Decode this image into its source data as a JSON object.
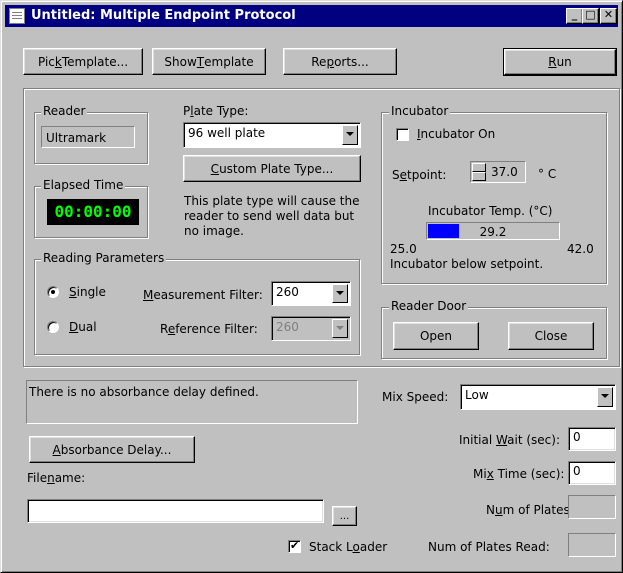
{
  "window": {
    "title": "Untitled: Multiple Endpoint Protocol",
    "minimize": "_",
    "maximize": "□",
    "close": "✕"
  },
  "toolbar": {
    "pick_template_pre": "Pic",
    "pick_template_u": "k",
    "pick_template_post": " Template...",
    "show_template_pre": "Show ",
    "show_template_u": "T",
    "show_template_post": "emplate",
    "reports_pre": "Re",
    "reports_u": "p",
    "reports_post": "orts...",
    "run_u": "R",
    "run_post": "un"
  },
  "reader": {
    "group_label": "Reader",
    "value": "Ultramark"
  },
  "elapsed": {
    "group_label": "Elapsed Time",
    "value": "00:00:00"
  },
  "plate": {
    "label_pre": "P",
    "label_u": "l",
    "label_post": "ate Type:",
    "selected": "96 well plate",
    "custom_u": "C",
    "custom_post": "ustom Plate Type...",
    "note": "This plate type will cause the reader to send well data but no image."
  },
  "reading_params": {
    "group_label": "Reading Parameters",
    "single_u": "S",
    "single_post": "ingle",
    "dual_u": "D",
    "dual_post": "ual",
    "meas_u": "M",
    "meas_post": "easurement Filter:",
    "meas_value": "260",
    "ref_pre": "R",
    "ref_u": "e",
    "ref_post": "ference Filter:",
    "ref_value": "260"
  },
  "incubator": {
    "group_label": "Incubator",
    "on_u": "I",
    "on_post": "ncubator On",
    "on_checked": false,
    "setpoint_pre": "S",
    "setpoint_u": "e",
    "setpoint_post": "tpoint:",
    "setpoint_value": "37.0",
    "unit": "° C",
    "temp_label": "Incubator Temp. (°C)",
    "temp_value": "29.2",
    "temp_fraction": 0.24,
    "min": "25.0",
    "max": "42.0",
    "status": "Incubator below setpoint."
  },
  "door": {
    "group_label": "Reader Door",
    "open": "Open",
    "close": "Close"
  },
  "delay": {
    "message": "There is no absorbance delay defined.",
    "button_u": "A",
    "button_post": "bsorbance Delay..."
  },
  "filename": {
    "label_pre": "File",
    "label_u": "n",
    "label_post": "ame:",
    "value": "",
    "browse": "..."
  },
  "stack_loader": {
    "label_pre": "Stack L",
    "label_u": "o",
    "label_post": "ader",
    "checked": true
  },
  "mix": {
    "label": "Mix Speed:",
    "value": "Low"
  },
  "initial_wait": {
    "pre": "Initial ",
    "u": "W",
    "post": "ait (sec):",
    "value": "0"
  },
  "mix_time": {
    "pre": "Mi",
    "u": "x",
    "post": " Time (sec):",
    "value": "0"
  },
  "num_plates": {
    "pre": "N",
    "u": "u",
    "post": "m of Plates:",
    "value": ""
  },
  "num_read": {
    "label": "Num of Plates Read:",
    "value": ""
  },
  "colors": {
    "titlebar": "#000080",
    "temp_fill": "#0000ff",
    "elapsed_text": "#00ff00",
    "face": "#c0c0c0"
  }
}
